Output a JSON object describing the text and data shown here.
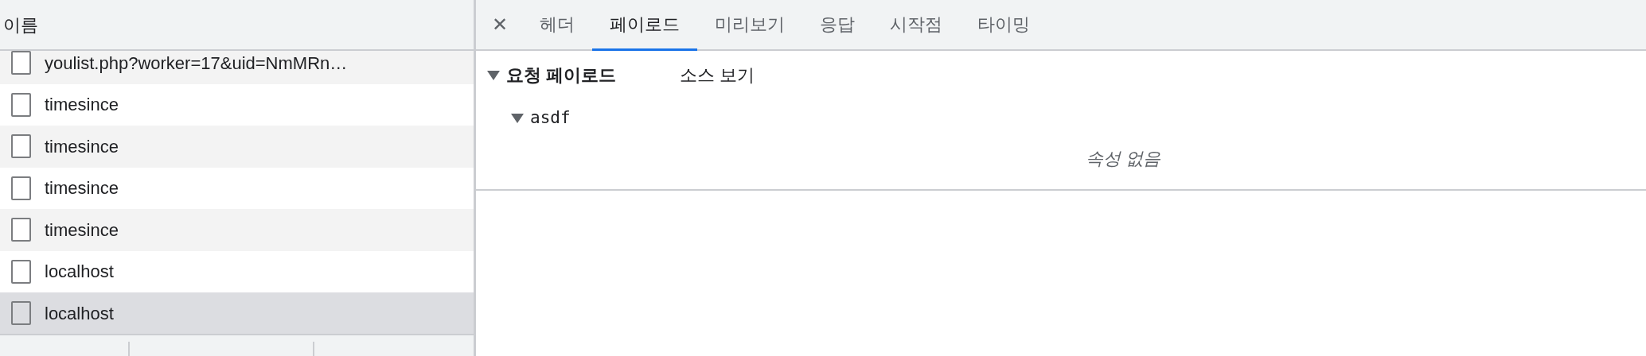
{
  "request_list": {
    "column_header": "이름",
    "rows": [
      {
        "name": "youlist.php?worker=17&uid=NmMRn…",
        "selected": false
      },
      {
        "name": "timesince",
        "selected": false
      },
      {
        "name": "timesince",
        "selected": false
      },
      {
        "name": "timesince",
        "selected": false
      },
      {
        "name": "timesince",
        "selected": false
      },
      {
        "name": "localhost",
        "selected": false
      },
      {
        "name": "localhost",
        "selected": true
      }
    ]
  },
  "detail": {
    "close_label": "✕",
    "tabs": [
      {
        "label": "헤더",
        "selected": false
      },
      {
        "label": "페이로드",
        "selected": true
      },
      {
        "label": "미리보기",
        "selected": false
      },
      {
        "label": "응답",
        "selected": false
      },
      {
        "label": "시작점",
        "selected": false
      },
      {
        "label": "타이밍",
        "selected": false
      }
    ],
    "payload": {
      "title": "요청 페이로드",
      "expanded": true,
      "view_source": "소스 보기",
      "params": [
        {
          "name": "asdf",
          "expanded": true,
          "empty_text": "속성 없음"
        }
      ]
    }
  }
}
